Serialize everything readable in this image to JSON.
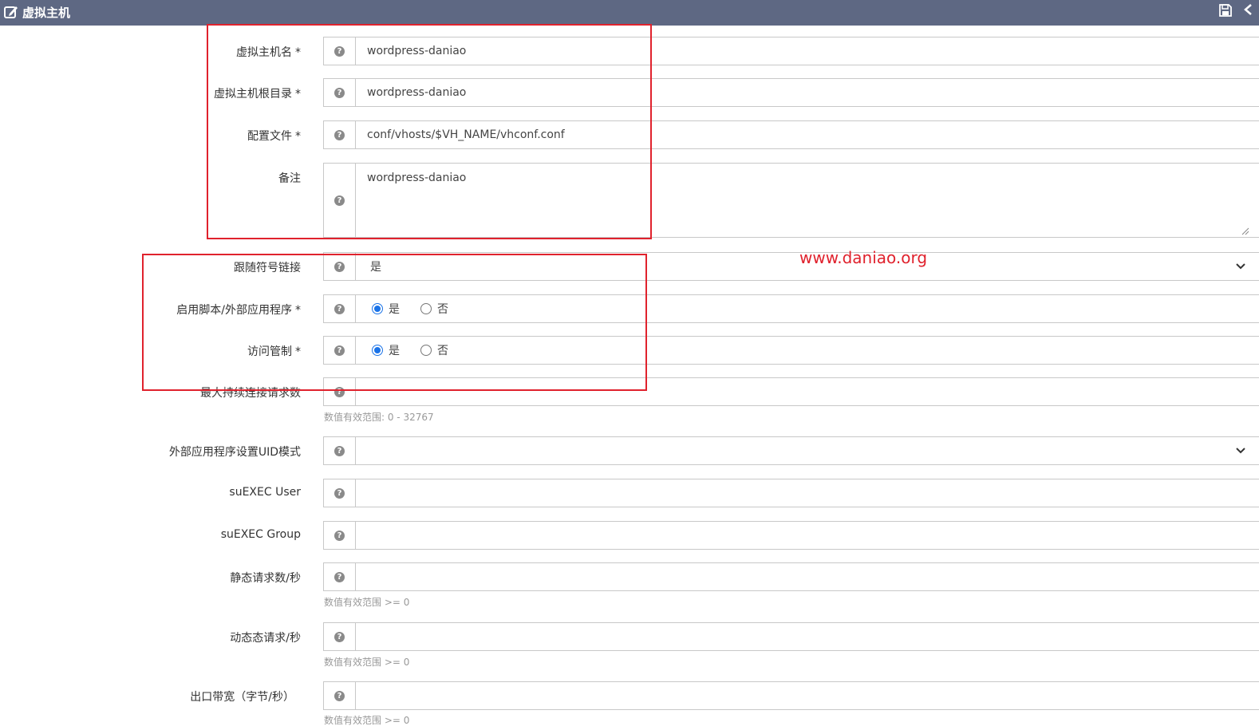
{
  "header": {
    "title": "虚拟主机",
    "edit_icon": "edit-icon",
    "save_icon": "save-icon",
    "collapse_icon": "collapse-icon",
    "bg_color": "#5e6883"
  },
  "watermark": "www.daniao.org",
  "highlight_color": "#e0222d",
  "form": {
    "vh_name": {
      "label": "虚拟主机名",
      "required": "*",
      "value": "wordpress-daniao"
    },
    "vh_root": {
      "label": "虚拟主机根目录",
      "required": "*",
      "value": "wordpress-daniao"
    },
    "config_file": {
      "label": "配置文件",
      "required": "*",
      "value": "conf/vhosts/$VH_NAME/vhconf.conf"
    },
    "notes": {
      "label": "备注",
      "value": "wordpress-daniao"
    },
    "follow_symlinks": {
      "label": "跟随符号链接",
      "value": "是"
    },
    "enable_scripts": {
      "label": "启用脚本/外部应用程序",
      "required": "*",
      "options": [
        "是",
        "否"
      ],
      "selected": "是"
    },
    "access_control": {
      "label": "访问管制",
      "required": "*",
      "options": [
        "是",
        "否"
      ],
      "selected": "是"
    },
    "max_keepalive": {
      "label": "最大持续连接请求数",
      "value": "",
      "hint": "数值有效范围: 0 - 32767"
    },
    "uid_mode": {
      "label": "外部应用程序设置UID模式",
      "value": ""
    },
    "suexec_user": {
      "label": "suEXEC User",
      "value": ""
    },
    "suexec_group": {
      "label": "suEXEC Group",
      "value": ""
    },
    "static_req": {
      "label": "静态请求数/秒",
      "value": "",
      "hint": "数值有效范围 >= 0"
    },
    "dynamic_req": {
      "label": "动态态请求/秒",
      "value": "",
      "hint": "数值有效范围 >= 0"
    },
    "bandwidth": {
      "label": "出口带宽（字节/秒）",
      "value": "",
      "hint": "数值有效范围 >= 0"
    }
  },
  "help_icon": "question-circle-icon",
  "chevron_icon": "chevron-down-icon"
}
